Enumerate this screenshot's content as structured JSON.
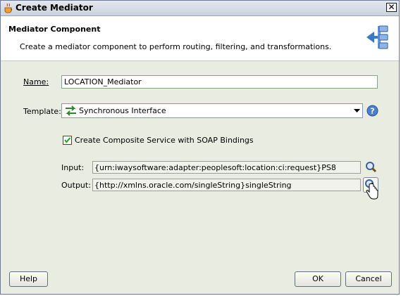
{
  "window": {
    "title": "Create Mediator",
    "close_label": "✕"
  },
  "header": {
    "title": "Mediator Component",
    "description": "Create a mediator component to perform routing, filtering, and transformations."
  },
  "form": {
    "name_label": "Name:",
    "name_value": "LOCATION_Mediator",
    "template_label": "Template:",
    "template_value": "Synchronous Interface",
    "checkbox_label": "Create Composite Service with SOAP Bindings",
    "checkbox_checked": true,
    "input_label": "Input:",
    "input_value": "{urn:iwaysoftware:adapter:peoplesoft:location:ci:request}PS8",
    "output_label": "Output:",
    "output_value": "{http://xmlns.oracle.com/singleString}singleString"
  },
  "footer": {
    "help_label": "Help",
    "ok_label": "OK",
    "cancel_label": "Cancel"
  },
  "icons": {
    "title": "coffee-cup-icon",
    "header": "mediator-icon",
    "template": "sync-arrows-icon",
    "dropdown": "chevron-down-icon",
    "help": "help-icon",
    "search": "search-icon",
    "cursor": "hand-cursor-icon"
  }
}
